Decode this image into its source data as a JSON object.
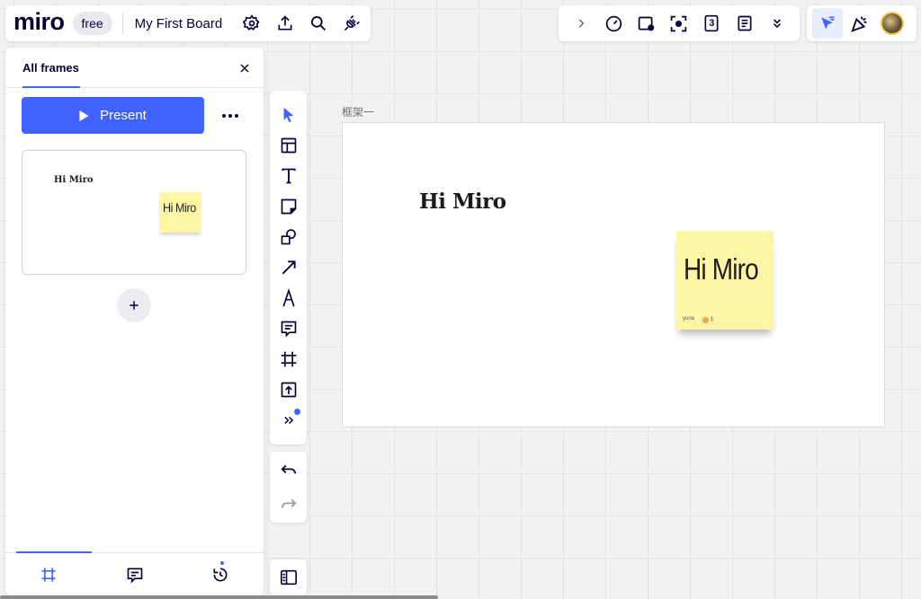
{
  "header": {
    "logo": "miro",
    "plan_badge": "free",
    "board_title": "My First Board",
    "icons": [
      "settings-icon",
      "upload-icon",
      "search-icon",
      "plug-icon"
    ]
  },
  "top_right": {
    "tools": [
      "chevron-right-icon",
      "timer-icon",
      "sticky-stack-icon",
      "focus-icon",
      "counter-icon",
      "notes-icon",
      "chevrons-down-icon"
    ],
    "counter_value": "3",
    "collab": [
      "cursor-share-icon",
      "celebrate-icon",
      "user-avatar"
    ]
  },
  "frames_panel": {
    "title": "All frames",
    "present_label": "Present",
    "thumb": {
      "text": "Hi Miro",
      "sticky_text": "Hi Miro"
    },
    "bottom_tabs": [
      "frames-icon",
      "comments-icon",
      "history-icon"
    ]
  },
  "toolbar": {
    "tools": [
      "select-icon",
      "templates-icon",
      "text-icon",
      "sticky-note-icon",
      "shapes-icon",
      "connection-line-icon",
      "pen-icon",
      "comment-icon",
      "frame-icon",
      "upload-icon",
      "more-tools-icon"
    ]
  },
  "board": {
    "frame_label": "框架一",
    "heading": "Hi Miro",
    "sticky": {
      "text": "Hi Miro",
      "author": "yuria",
      "reaction_count": "1"
    }
  },
  "colors": {
    "accent": "#4262ff",
    "sticky": "#fff6a5",
    "ink": "#050038"
  }
}
